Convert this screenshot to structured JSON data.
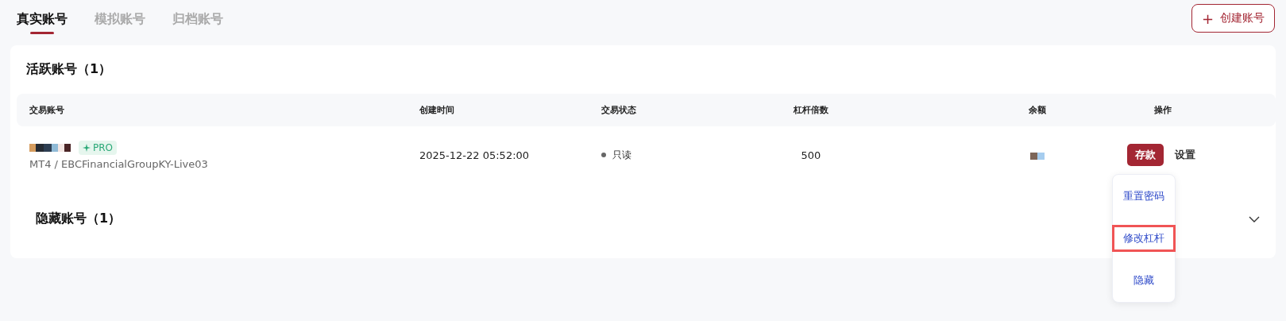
{
  "tabs": [
    {
      "label": "真实账号",
      "selected": true
    },
    {
      "label": "模拟账号",
      "selected": false
    },
    {
      "label": "归档账号",
      "selected": false
    }
  ],
  "create_button": {
    "icon": "+",
    "label": "创建账号"
  },
  "active_section": {
    "title": "活跃账号（1）",
    "columns": [
      "交易账号",
      "创建时间",
      "交易状态",
      "杠杆倍数",
      "余额",
      "操作"
    ],
    "rows": [
      {
        "badge": "PRO",
        "server": "MT4 / EBCFinancialGroupKY-Live03",
        "created": "2025-12-22 05:52:00",
        "status": "只读",
        "leverage": "500",
        "deposit_button": "存款",
        "settings_button": "设置"
      }
    ]
  },
  "settings_menu": [
    {
      "label": "重置密码",
      "highlighted": false
    },
    {
      "label": "修改杠杆",
      "highlighted": true
    },
    {
      "label": "隐藏",
      "highlighted": false
    }
  ],
  "hidden_section": {
    "title": "隐藏账号（1）",
    "expanded": false
  }
}
